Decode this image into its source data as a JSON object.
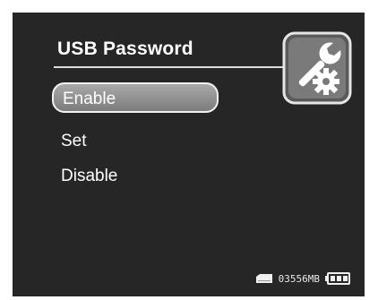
{
  "screen": {
    "title": "USB Password",
    "icon": "settings-wrench-gear-icon"
  },
  "menu": {
    "items": [
      {
        "label": "Enable",
        "selected": true
      },
      {
        "label": "Set",
        "selected": false
      },
      {
        "label": "Disable",
        "selected": false
      }
    ]
  },
  "status": {
    "storage_icon": "storage-card-icon",
    "storage_text": "03556MB",
    "battery_icon": "battery-full-icon"
  },
  "colors": {
    "background": "#262626",
    "text": "#ffffff",
    "selection": "#8f8f8f"
  }
}
